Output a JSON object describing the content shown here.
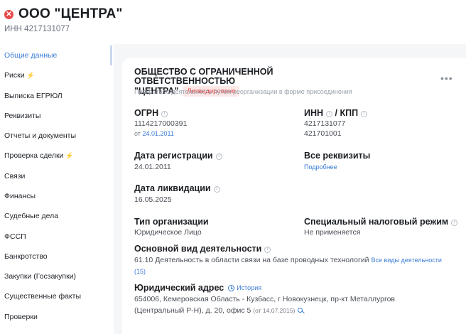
{
  "header": {
    "status_icon": "x-icon",
    "title": "ООО \"ЦЕНТРА\"",
    "inn_line": "ИНН 4217131077"
  },
  "sidebar": {
    "items": [
      {
        "label": "Общие данные",
        "active": true
      },
      {
        "label": "Риски",
        "bolt": true
      },
      {
        "label": "Выписка ЕГРЮЛ"
      },
      {
        "label": "Реквизиты"
      },
      {
        "label": "Отчеты и документы"
      },
      {
        "label": "Проверка сделки",
        "bolt": true
      },
      {
        "label": "Связи"
      },
      {
        "label": "Финансы"
      },
      {
        "label": "Судебные дела"
      },
      {
        "label": "ФССП"
      },
      {
        "label": "Банкротство"
      },
      {
        "label": "Закупки (Госзакупки)"
      },
      {
        "label": "Существенные факты"
      },
      {
        "label": "Проверки"
      }
    ],
    "bolt_glyph": "⚡",
    "colors": {
      "active": "#3a7bd5",
      "bolt": "#f0a030"
    }
  },
  "card": {
    "more_glyph": "•••",
    "full_name_line1": "ОБЩЕСТВО С ОГРАНИЧЕННОЙ ОТВЕТСТВЕННОСТЬЮ",
    "full_name_line2": "\"ЦЕНТРА\"",
    "status_badge": "Ликвидировано",
    "reason": "Прекратило деятельность путем реорганизации в форме присоединения",
    "ogrn": {
      "label": "ОГРН",
      "value": "1114217000391",
      "date_prefix": "от",
      "date": "24.01.2011"
    },
    "inn_kpp": {
      "label_inn": "ИНН",
      "label_sep": "/ КПП",
      "inn": "4217131077",
      "kpp": "421701001"
    },
    "reg_date": {
      "label": "Дата регистрации",
      "value": "24.01.2011"
    },
    "all_requisites": {
      "label": "Все реквизиты",
      "link": "Подробнее"
    },
    "liq_date": {
      "label": "Дата ликвидации",
      "value": "16.05.2025"
    },
    "org_type": {
      "label": "Тип организации",
      "value": "Юридическое Лицо"
    },
    "tax_regime": {
      "label": "Специальный налоговый режим",
      "value": "Не применяется"
    },
    "activity": {
      "label": "Основной вид деятельности",
      "value": "61.10 Деятельность в области связи на базе проводных технологий",
      "link": "Все виды деятельности",
      "count": "(15)"
    },
    "address": {
      "label": "Юридический адрес",
      "history_link": "История",
      "line1": "654006, Кемеровская Область - Кузбасс, г Новокузнецк, пр-кт Металлургов",
      "line2": "(Центральный Р-Н), д. 20, офис 5",
      "since": "(от 14.07.2015)"
    },
    "colors": {
      "link": "#3a7bd5",
      "badge_text": "#e84a4a",
      "badge_bg": "#fde8e8"
    }
  }
}
